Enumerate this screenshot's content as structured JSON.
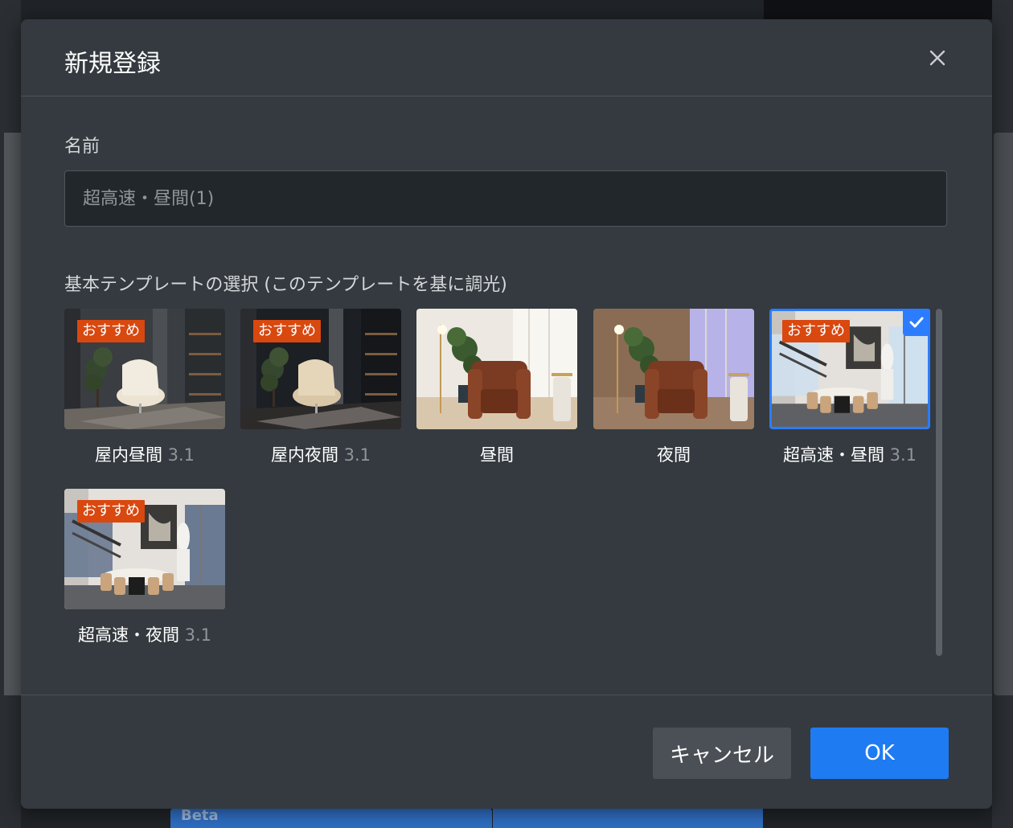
{
  "dialog": {
    "title": "新規登録",
    "name_label": "名前",
    "name_placeholder": "超高速・昼間(1)",
    "name_value": "",
    "template_label": "基本テンプレートの選択 (このテンプレートを基に調光)",
    "cancel_label": "キャンセル",
    "ok_label": "OK"
  },
  "templates": [
    {
      "name": "屋内昼間",
      "version": "3.1",
      "badge": "おすすめ",
      "selected": false,
      "scene": "chair-day"
    },
    {
      "name": "屋内夜間",
      "version": "3.1",
      "badge": "おすすめ",
      "selected": false,
      "scene": "chair-night"
    },
    {
      "name": "昼間",
      "version": "",
      "badge": "",
      "selected": false,
      "scene": "armchair-day"
    },
    {
      "name": "夜間",
      "version": "",
      "badge": "",
      "selected": false,
      "scene": "armchair-night"
    },
    {
      "name": "超高速・昼間",
      "version": "3.1",
      "badge": "おすすめ",
      "selected": true,
      "scene": "dining-day"
    },
    {
      "name": "超高速・夜間",
      "version": "3.1",
      "badge": "おすすめ",
      "selected": false,
      "scene": "dining-night"
    }
  ],
  "background": {
    "beta_label": "Beta"
  },
  "colors": {
    "accent": "#1f7bf2",
    "badge": "#d9480f",
    "modal_bg": "#343a3f"
  }
}
